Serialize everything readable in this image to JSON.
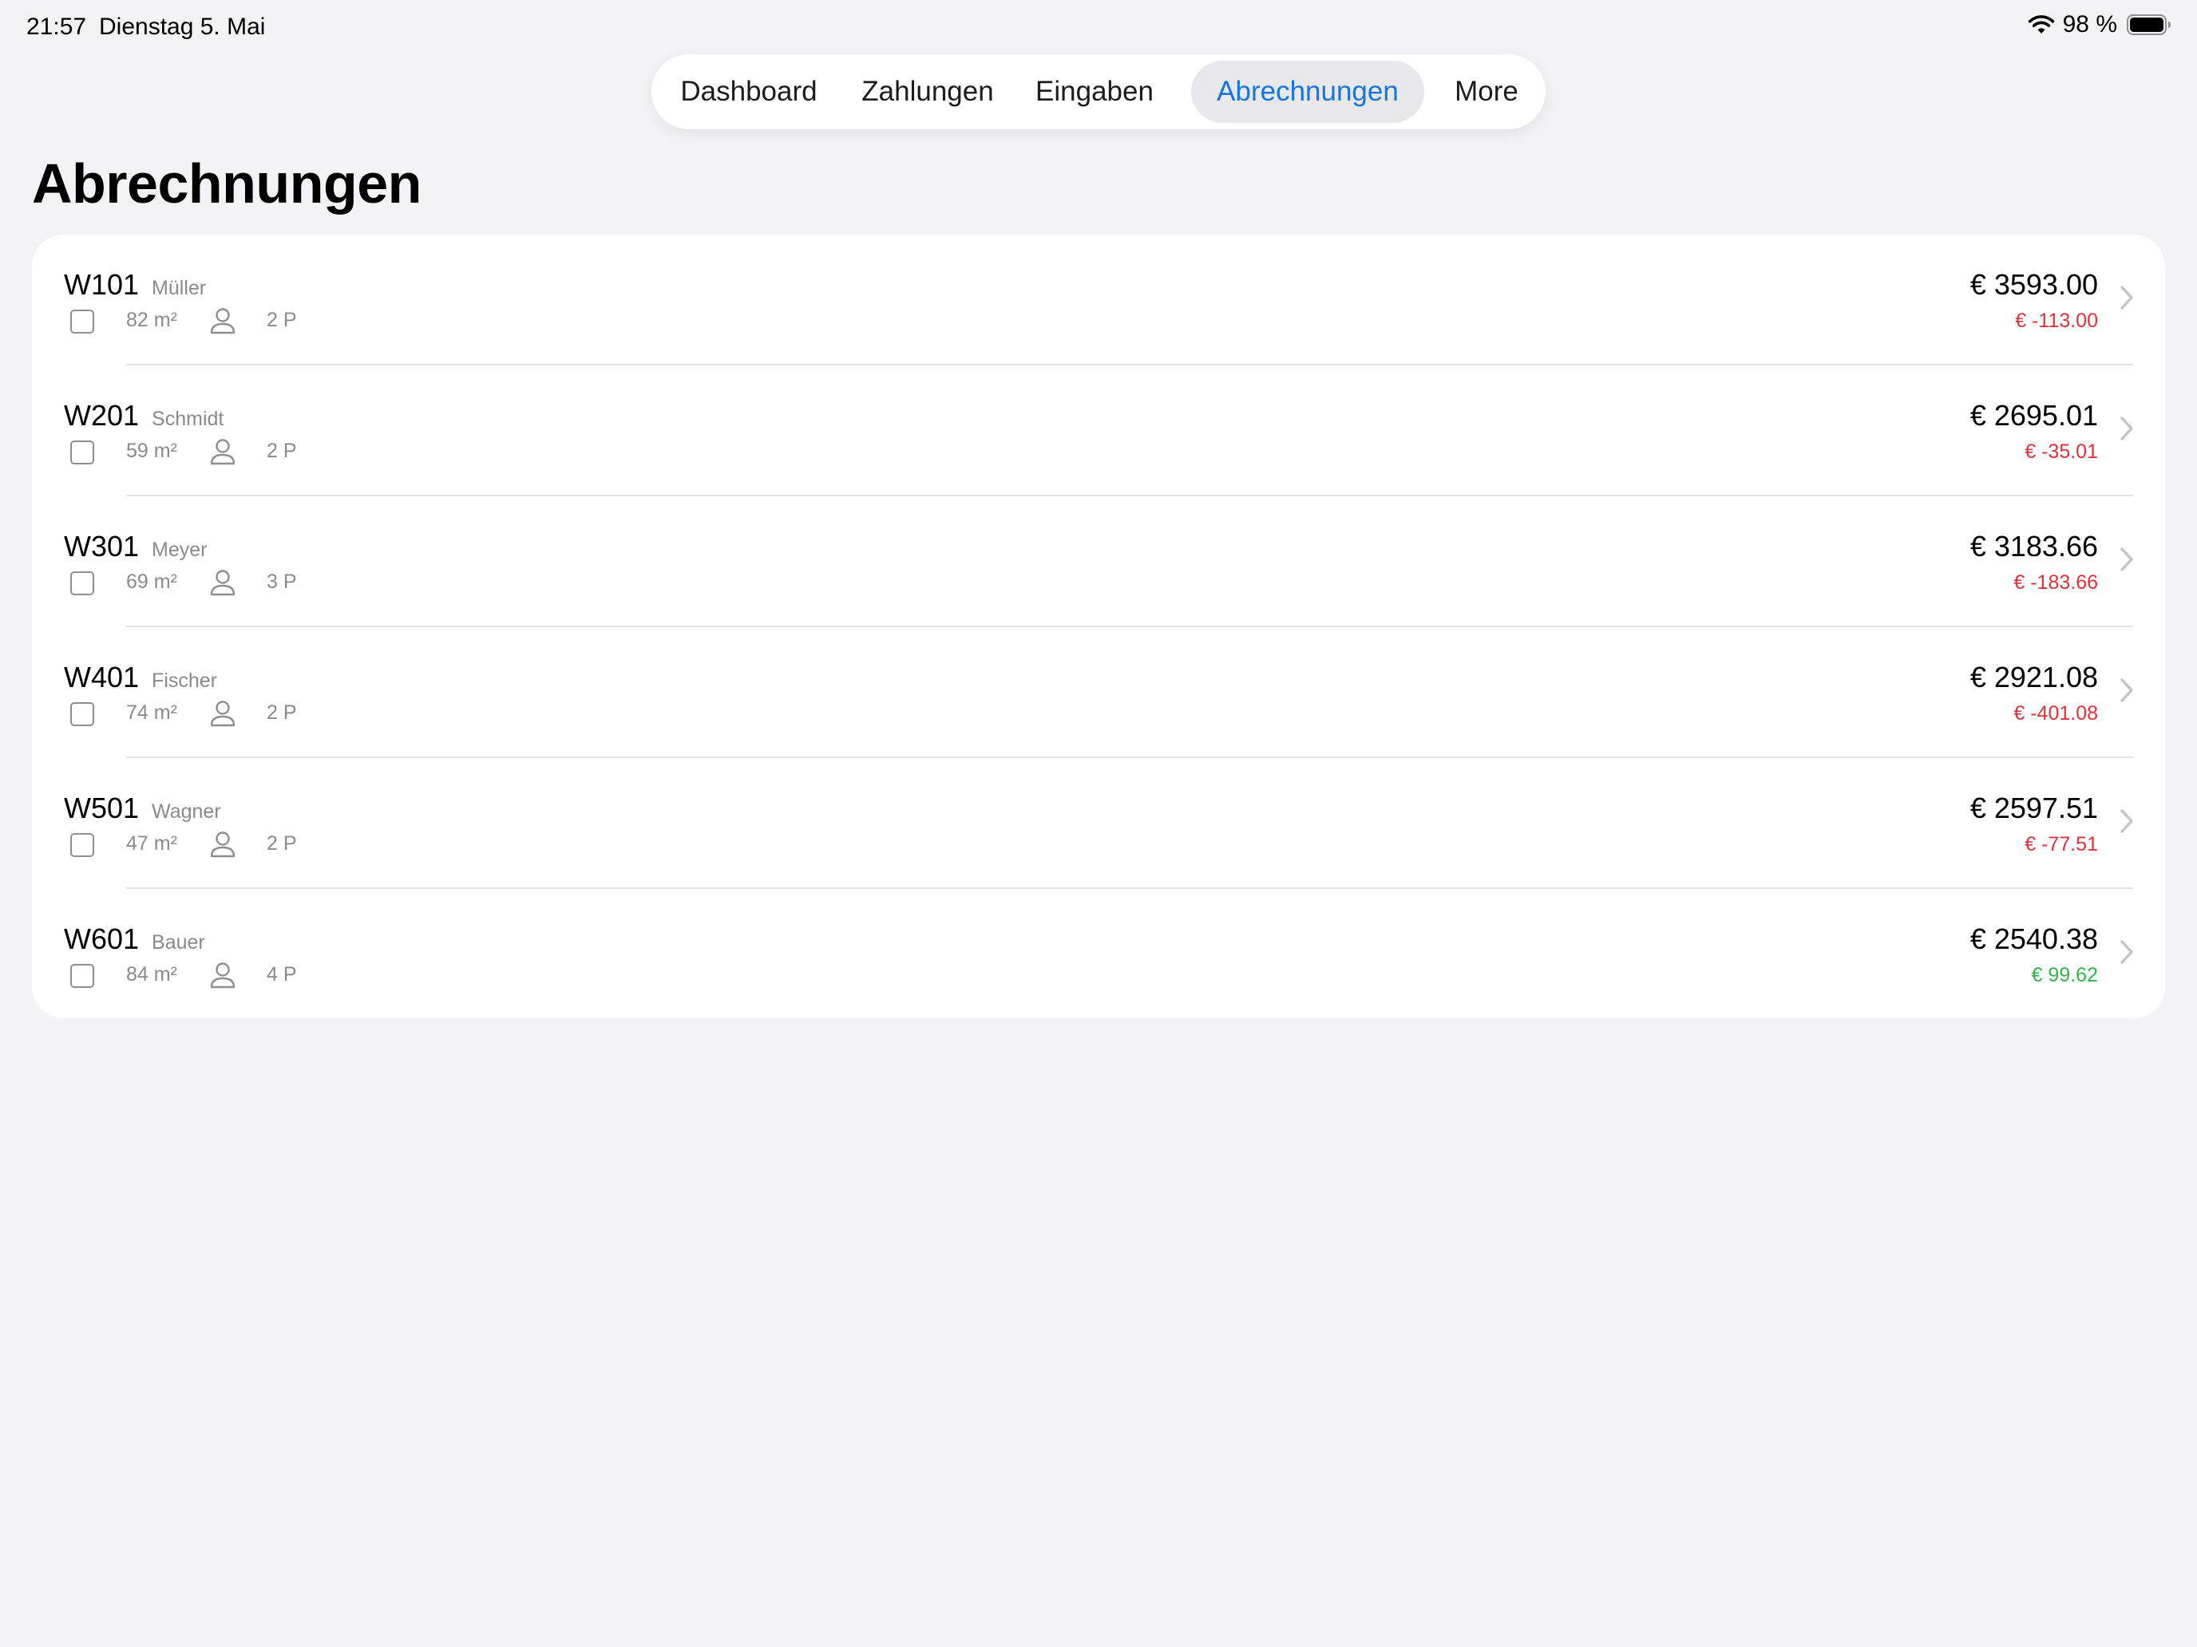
{
  "status_bar": {
    "time": "21:57",
    "date": "Dienstag 5. Mai",
    "battery": "98 %",
    "icons": [
      "wifi-icon",
      "battery-icon"
    ]
  },
  "tabs": [
    {
      "label": "Dashboard",
      "active": false
    },
    {
      "label": "Zahlungen",
      "active": false
    },
    {
      "label": "Eingaben",
      "active": false
    },
    {
      "label": "Abrechnungen",
      "active": true
    },
    {
      "label": "More",
      "active": false
    }
  ],
  "title": "Abrechnungen",
  "colors": {
    "accent": "#1776DE",
    "negative": "#E0303B",
    "positive": "#34B34A",
    "secondary_text": "#8A8A8E",
    "background": "#F2F2F7"
  },
  "units": [
    {
      "id": "W101",
      "tenant": "Müller",
      "area": "82 m²",
      "persons": "2 P",
      "amount": "€ 3593.00",
      "diff": "€ -113.00",
      "diff_sign": "neg"
    },
    {
      "id": "W201",
      "tenant": "Schmidt",
      "area": "59 m²",
      "persons": "2 P",
      "amount": "€ 2695.01",
      "diff": "€ -35.01",
      "diff_sign": "neg"
    },
    {
      "id": "W301",
      "tenant": "Meyer",
      "area": "69 m²",
      "persons": "3 P",
      "amount": "€ 3183.66",
      "diff": "€ -183.66",
      "diff_sign": "neg"
    },
    {
      "id": "W401",
      "tenant": "Fischer",
      "area": "74 m²",
      "persons": "2 P",
      "amount": "€ 2921.08",
      "diff": "€ -401.08",
      "diff_sign": "neg"
    },
    {
      "id": "W501",
      "tenant": "Wagner",
      "area": "47 m²",
      "persons": "2 P",
      "amount": "€ 2597.51",
      "diff": "€ -77.51",
      "diff_sign": "neg"
    },
    {
      "id": "W601",
      "tenant": "Bauer",
      "area": "84 m²",
      "persons": "4 P",
      "amount": "€ 2540.38",
      "diff": "€ 99.62",
      "diff_sign": "pos"
    }
  ]
}
